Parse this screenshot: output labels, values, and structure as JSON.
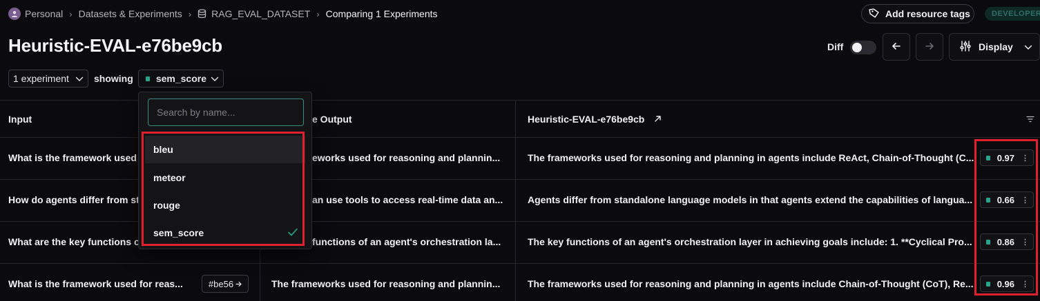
{
  "breadcrumb": {
    "items": [
      "Personal",
      "Datasets & Experiments",
      "RAG_EVAL_DATASET",
      "Comparing 1 Experiments"
    ]
  },
  "header": {
    "add_tags_label": "Add resource tags",
    "badge": "DEVELOPER",
    "title": "Heuristic-EVAL-e76be9cb",
    "diff_label": "Diff",
    "display_label": "Display"
  },
  "filters": {
    "experiment_select": "1 experiment",
    "showing_label": "showing",
    "metric_select": "sem_score"
  },
  "dropdown": {
    "search_placeholder": "Search by name...",
    "options": [
      "bleu",
      "meteor",
      "rouge",
      "sem_score"
    ],
    "selected": "sem_score"
  },
  "table": {
    "headers": {
      "input": "Input",
      "reference": "Reference Output",
      "reference_visible": "e Output",
      "experiment": "Heuristic-EVAL-e76be9cb"
    },
    "rows": [
      {
        "input": "What is the framework used",
        "reference": "eworks used for reasoning and plannin...",
        "output": "The frameworks used for reasoning and planning in agents include ReAct, Chain-of-Thought (C...",
        "score": "0.97"
      },
      {
        "input": "How do agents differ from st",
        "reference": "an use tools to access real-time data an...",
        "output": "Agents differ from standalone language models in that agents extend the capabilities of langua...",
        "score": "0.66"
      },
      {
        "input": "What are the key functions o",
        "reference": "functions of an agent's orchestration la...",
        "output": "The key functions of an agent's orchestration layer in achieving goals include: 1. **Cyclical Pro...",
        "score": "0.86"
      },
      {
        "input": "What is the framework used for reas...",
        "ref_tag": "#be56",
        "reference": "The frameworks used for reasoning and plannin...",
        "output": "The frameworks used for reasoning and planning in agents include Chain-of-Thought (CoT), Re...",
        "score": "0.96"
      }
    ]
  },
  "colors": {
    "background": "#0b0b0d",
    "accent": "#29a38c",
    "highlight": "#e0202e"
  }
}
